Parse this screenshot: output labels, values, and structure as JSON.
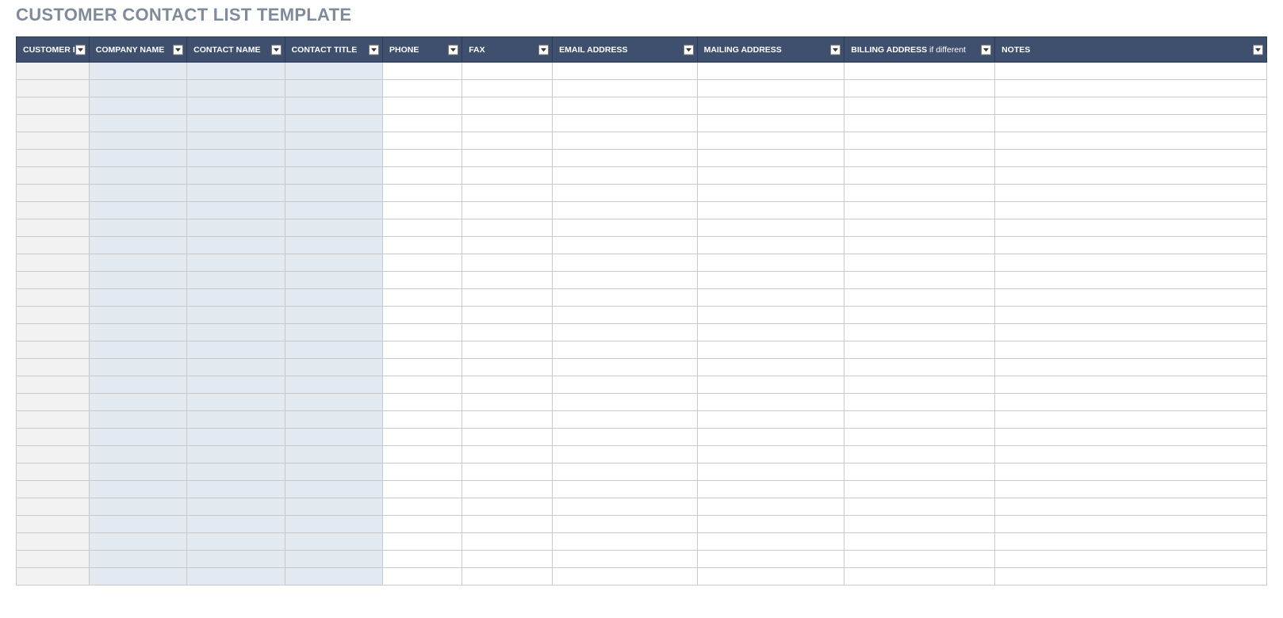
{
  "title": "CUSTOMER CONTACT LIST TEMPLATE",
  "columns": [
    {
      "label": "CUSTOMER ID",
      "sub": "",
      "shade": "gray"
    },
    {
      "label": "COMPANY NAME",
      "sub": "",
      "shade": "blue"
    },
    {
      "label": "CONTACT NAME",
      "sub": "",
      "shade": "blue"
    },
    {
      "label": "CONTACT TITLE",
      "sub": "",
      "shade": "blue"
    },
    {
      "label": "PHONE",
      "sub": "",
      "shade": "white"
    },
    {
      "label": "FAX",
      "sub": "",
      "shade": "white"
    },
    {
      "label": "EMAIL ADDRESS",
      "sub": "",
      "shade": "white"
    },
    {
      "label": "MAILING ADDRESS",
      "sub": "",
      "shade": "white"
    },
    {
      "label": "BILLING ADDRESS",
      "sub": "if different",
      "shade": "white"
    },
    {
      "label": "NOTES",
      "sub": "",
      "shade": "white"
    }
  ],
  "rows": [
    [
      "",
      "",
      "",
      "",
      "",
      "",
      "",
      "",
      "",
      ""
    ],
    [
      "",
      "",
      "",
      "",
      "",
      "",
      "",
      "",
      "",
      ""
    ],
    [
      "",
      "",
      "",
      "",
      "",
      "",
      "",
      "",
      "",
      ""
    ],
    [
      "",
      "",
      "",
      "",
      "",
      "",
      "",
      "",
      "",
      ""
    ],
    [
      "",
      "",
      "",
      "",
      "",
      "",
      "",
      "",
      "",
      ""
    ],
    [
      "",
      "",
      "",
      "",
      "",
      "",
      "",
      "",
      "",
      ""
    ],
    [
      "",
      "",
      "",
      "",
      "",
      "",
      "",
      "",
      "",
      ""
    ],
    [
      "",
      "",
      "",
      "",
      "",
      "",
      "",
      "",
      "",
      ""
    ],
    [
      "",
      "",
      "",
      "",
      "",
      "",
      "",
      "",
      "",
      ""
    ],
    [
      "",
      "",
      "",
      "",
      "",
      "",
      "",
      "",
      "",
      ""
    ],
    [
      "",
      "",
      "",
      "",
      "",
      "",
      "",
      "",
      "",
      ""
    ],
    [
      "",
      "",
      "",
      "",
      "",
      "",
      "",
      "",
      "",
      ""
    ],
    [
      "",
      "",
      "",
      "",
      "",
      "",
      "",
      "",
      "",
      ""
    ],
    [
      "",
      "",
      "",
      "",
      "",
      "",
      "",
      "",
      "",
      ""
    ],
    [
      "",
      "",
      "",
      "",
      "",
      "",
      "",
      "",
      "",
      ""
    ],
    [
      "",
      "",
      "",
      "",
      "",
      "",
      "",
      "",
      "",
      ""
    ],
    [
      "",
      "",
      "",
      "",
      "",
      "",
      "",
      "",
      "",
      ""
    ],
    [
      "",
      "",
      "",
      "",
      "",
      "",
      "",
      "",
      "",
      ""
    ],
    [
      "",
      "",
      "",
      "",
      "",
      "",
      "",
      "",
      "",
      ""
    ],
    [
      "",
      "",
      "",
      "",
      "",
      "",
      "",
      "",
      "",
      ""
    ],
    [
      "",
      "",
      "",
      "",
      "",
      "",
      "",
      "",
      "",
      ""
    ],
    [
      "",
      "",
      "",
      "",
      "",
      "",
      "",
      "",
      "",
      ""
    ],
    [
      "",
      "",
      "",
      "",
      "",
      "",
      "",
      "",
      "",
      ""
    ],
    [
      "",
      "",
      "",
      "",
      "",
      "",
      "",
      "",
      "",
      ""
    ],
    [
      "",
      "",
      "",
      "",
      "",
      "",
      "",
      "",
      "",
      ""
    ],
    [
      "",
      "",
      "",
      "",
      "",
      "",
      "",
      "",
      "",
      ""
    ],
    [
      "",
      "",
      "",
      "",
      "",
      "",
      "",
      "",
      "",
      ""
    ],
    [
      "",
      "",
      "",
      "",
      "",
      "",
      "",
      "",
      "",
      ""
    ],
    [
      "",
      "",
      "",
      "",
      "",
      "",
      "",
      "",
      "",
      ""
    ],
    [
      "",
      "",
      "",
      "",
      "",
      "",
      "",
      "",
      "",
      ""
    ]
  ]
}
